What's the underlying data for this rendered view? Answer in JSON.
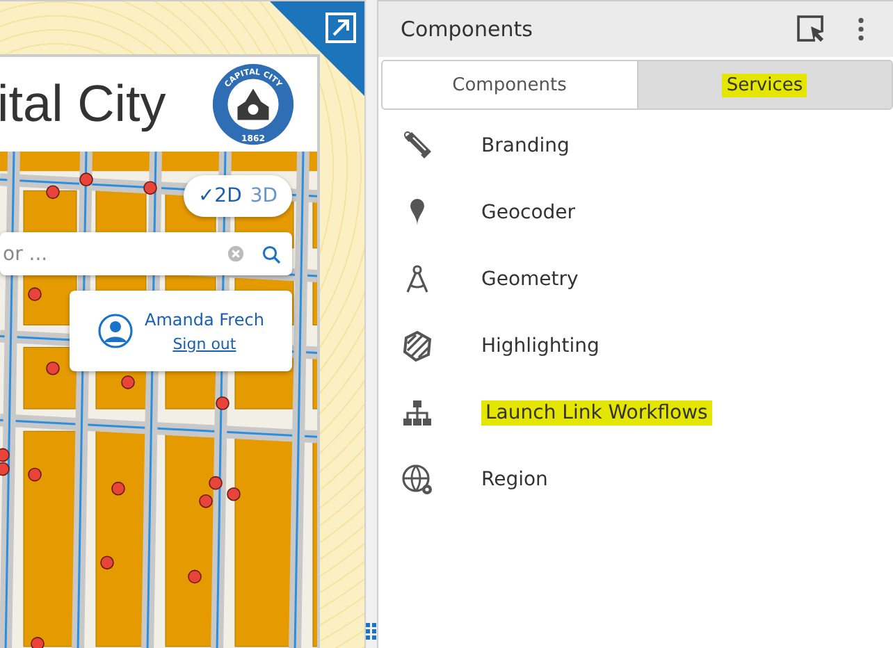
{
  "app_preview": {
    "title": "ital City",
    "logo": {
      "top_text": "CAPITAL CITY",
      "year": "1862"
    },
    "view_toggle": [
      {
        "label": "✓2D",
        "selected": true
      },
      {
        "label": "3D",
        "selected": false
      }
    ],
    "search": {
      "placeholder": "or ..."
    },
    "user": {
      "name": "Amanda Frech",
      "link": "Sign out"
    }
  },
  "panel": {
    "title": "Components",
    "tabs": [
      {
        "label": "Components",
        "selected": true,
        "highlighted": false
      },
      {
        "label": "Services",
        "selected": false,
        "highlighted": true
      }
    ],
    "items": [
      {
        "label": "Branding",
        "kind": "brush",
        "highlighted": false
      },
      {
        "label": "Geocoder",
        "kind": "pin",
        "highlighted": false
      },
      {
        "label": "Geometry",
        "kind": "compass",
        "highlighted": false
      },
      {
        "label": "Highlighting",
        "kind": "hatch",
        "highlighted": false
      },
      {
        "label": "Launch Link Workflows",
        "kind": "tree",
        "highlighted": true
      },
      {
        "label": "Region",
        "kind": "globe",
        "highlighted": false
      }
    ]
  }
}
